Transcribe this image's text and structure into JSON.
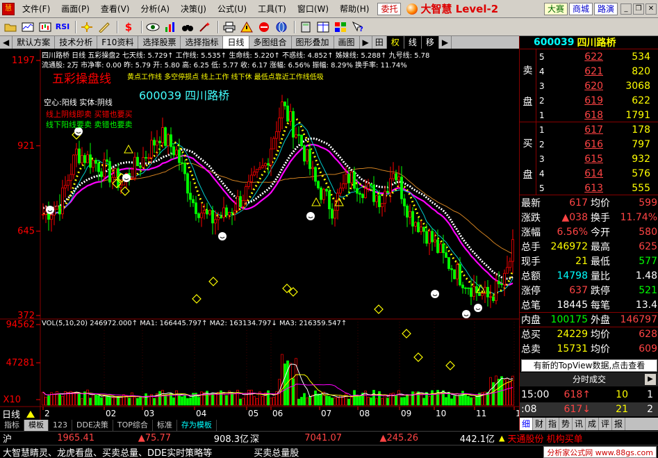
{
  "menu": {
    "items": [
      "文件(F)",
      "画面(P)",
      "查看(V)",
      "分析(A)",
      "决策(J)",
      "公式(U)",
      "工具(T)",
      "窗口(W)",
      "帮助(H)"
    ],
    "entrust": "委托",
    "logo": "大智慧 Level-2",
    "dasai": "大赛",
    "shop": "商城",
    "route": "路演"
  },
  "toolbar": {
    "icons": [
      "open-folder-icon",
      "intraday-chart-icon",
      "kline-chart-icon",
      "rsi-indicator-icon",
      "crosshair-icon",
      "ruler-icon",
      "dollar-icon",
      "eye-icon",
      "bar-chart-icon",
      "binoculars-icon",
      "magic-wand-icon",
      "print-icon",
      "warning-icon",
      "no-entry-icon",
      "globe-icon",
      "calculator-icon",
      "grid-window-icon",
      "layout-icon",
      "help-icon"
    ],
    "rsi": "RSI",
    "dollar": "$"
  },
  "chart_tabs": {
    "items": [
      "默认方案",
      "技术分析",
      "F10资料",
      "选择股票",
      "选择指标",
      "日线",
      "多图组合",
      "图形叠加",
      "画图"
    ],
    "small": [
      "田",
      "权",
      "线",
      "移"
    ]
  },
  "chart_info": {
    "line1": "四川路桥 日线  五彩操盘2  七天线: 5.729↑ 工作线: 5.535↑ 生命线: 5.220↑ 不惑线: 4.852↑ 姊妹线: 5.288↑ 九号线: 5.78",
    "line2": "流通股: 2万 市净率: 0.00 昨: 5.79 开: 5.80 高: 6.25 低: 5.77 收: 6.17 涨幅: 6.56% 振幅: 8.29% 换手率: 11.74%",
    "overlay_title": "五彩操盘线",
    "overlay_sub": "黄点工作线 多空停损点 线上工作 线下休 最低点靠近工作线低吸",
    "watermark": "600039  四川路桥",
    "legend1": "空心:阳线 实体:阴线",
    "legend2": "线上阴线即卖 买错也要买",
    "legend3": "线下阳线要卖 卖错也要卖",
    "vol_label": "VOL(5,10,20) 246972.000↑ MA1: 166445.797↑ MA2: 163134.797↓ MA3: 216359.547↑",
    "period_label": "日线",
    "y_main": [
      "1197",
      "921",
      "645",
      "372"
    ],
    "y_vol": [
      "94562",
      "47281",
      "X10"
    ],
    "x_months": [
      "2",
      "02",
      "03",
      "04",
      "05",
      "06",
      "07",
      "08",
      "09",
      "10",
      "11",
      "12"
    ]
  },
  "chart_data": {
    "type": "candlestick",
    "ylim": [
      372,
      1197
    ],
    "vol_ylim": [
      0,
      94562
    ]
  },
  "bottom_tabs": [
    "指标",
    "模板",
    "123",
    "DDE决策",
    "TOP综合",
    "标准",
    "存为模板"
  ],
  "stock": {
    "code": "600039",
    "name": "四川路桥"
  },
  "sell_side_label": [
    "卖",
    "盘"
  ],
  "buy_side_label": [
    "买",
    "盘"
  ],
  "sell": [
    {
      "level": "5",
      "price": "622",
      "vol": "534"
    },
    {
      "level": "4",
      "price": "621",
      "vol": "820"
    },
    {
      "level": "3",
      "price": "620",
      "vol": "3068"
    },
    {
      "level": "2",
      "price": "619",
      "vol": "622"
    },
    {
      "level": "1",
      "price": "618",
      "vol": "1791"
    }
  ],
  "buy": [
    {
      "level": "1",
      "price": "617",
      "vol": "178"
    },
    {
      "level": "2",
      "price": "616",
      "vol": "797"
    },
    {
      "level": "3",
      "price": "615",
      "vol": "932"
    },
    {
      "level": "4",
      "price": "614",
      "vol": "576"
    },
    {
      "level": "5",
      "price": "613",
      "vol": "555"
    }
  ],
  "quotes": [
    {
      "k": "最新",
      "v": "617",
      "vc": "red",
      "k2": "均价",
      "v2": "599",
      "v2c": "red"
    },
    {
      "k": "涨跌",
      "v": "▲038",
      "vc": "red",
      "k2": "换手",
      "v2": "11.74%",
      "v2c": "red"
    },
    {
      "k": "涨幅",
      "v": "6.56%",
      "vc": "red",
      "k2": "今开",
      "v2": "580",
      "v2c": "red"
    },
    {
      "k": "总手",
      "v": "246972",
      "vc": "yellow",
      "k2": "最高",
      "v2": "625",
      "v2c": "red"
    },
    {
      "k": "现手",
      "v": "21",
      "vc": "yellow",
      "k2": "最低",
      "v2": "577",
      "v2c": "green"
    },
    {
      "k": "总额",
      "v": "14798",
      "vc": "cyan",
      "k2": "量比",
      "v2": "1.48",
      "v2c": "white"
    },
    {
      "k": "涨停",
      "v": "637",
      "vc": "red",
      "k2": "跌停",
      "v2": "521",
      "v2c": "green"
    },
    {
      "k": "总笔",
      "v": "18445",
      "vc": "white",
      "k2": "每笔",
      "v2": "13.4",
      "v2c": "white"
    },
    {
      "k": "内盘",
      "v": "100175",
      "vc": "green",
      "k2": "外盘",
      "v2": "146797",
      "v2c": "red"
    },
    {
      "k": "总买",
      "v": "24229",
      "vc": "yellow",
      "k2": "均价",
      "v2": "628",
      "v2c": "red"
    },
    {
      "k": "总卖",
      "v": "15731",
      "vc": "yellow",
      "k2": "均价",
      "v2": "609",
      "v2c": "red"
    }
  ],
  "topview": "有新的TopView数据,点击查看",
  "tick_header": "分时成交",
  "ticks": [
    {
      "t": "15:00",
      "p": "618↑",
      "pc": "red",
      "q": "10",
      "n": "1"
    },
    {
      "t": ":08",
      "p": "617↓",
      "pc": "red",
      "q": "21",
      "n": "2"
    }
  ],
  "right_tabs": [
    "细",
    "财",
    "指",
    "势",
    "讯",
    "成",
    "评",
    "报"
  ],
  "status": {
    "sh_label": "沪",
    "sh_index": "1965.41",
    "sh_change": "▲75.77",
    "sh_amount": "908.3亿",
    "sz_label": "深",
    "sz_index": "7041.07",
    "sz_change": "▲245.26",
    "sz_amount": "442.1亿",
    "news": "天通股份 机构买单"
  },
  "ticker": {
    "text": "大智慧睛灵、龙虎看盘、买卖总量、DDE实时策略等",
    "text2": "买卖总量股",
    "ad": "分析家公式网 www.88gs.com"
  }
}
